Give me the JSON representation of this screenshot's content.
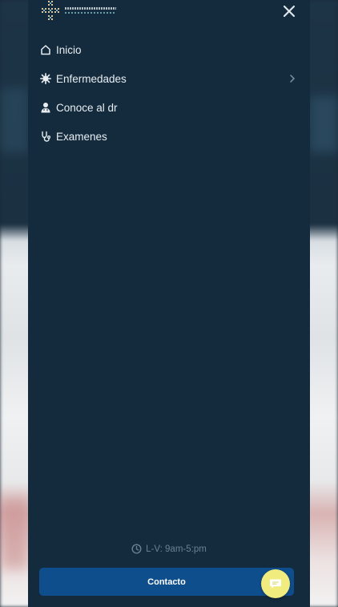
{
  "menu": {
    "items": [
      {
        "label": "Inicio",
        "icon": "home-icon"
      },
      {
        "label": "Enfermedades",
        "icon": "virus-icon",
        "has_submenu": true
      },
      {
        "label": "Conoce al dr",
        "icon": "doctor-icon"
      },
      {
        "label": "Examenes",
        "icon": "stethoscope-icon"
      }
    ]
  },
  "footer": {
    "hours": "L-V: 9am-5:pm",
    "contact_label": "Contacto"
  },
  "colors": {
    "drawer_bg": "#132b3d",
    "contact_button": "#0f4e8c",
    "chat_bubble": "#f0ec7e",
    "menu_text": "#e9eef2",
    "hours_text": "#6c8090"
  }
}
